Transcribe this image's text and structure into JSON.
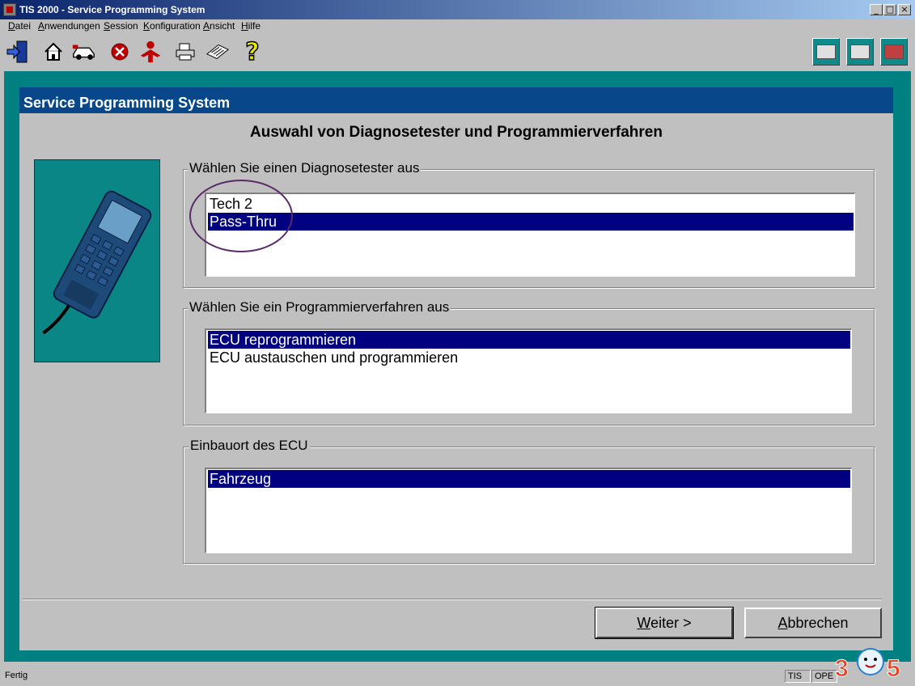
{
  "window": {
    "title": "TIS 2000 - Service Programming System",
    "controls": [
      "_",
      "□",
      "×"
    ]
  },
  "menu": [
    "Datei",
    "Anwendungen",
    "Session",
    "Konfiguration",
    "Ansicht",
    "Hilfe"
  ],
  "toolbar": {
    "icons": [
      "exit-icon",
      "home-icon",
      "vehicle-icon",
      "stop-icon",
      "person-icon",
      "printer-icon",
      "notebook-icon",
      "help-icon"
    ],
    "help_glyph": "?",
    "right_icons": [
      "diagnostic-device-icon",
      "computer-icon",
      "vehicle-programming-icon"
    ]
  },
  "panel": {
    "header": "Service Programming System",
    "heading": "Auswahl von Diagnosetester und Programmierverfahren"
  },
  "groups": {
    "tester": {
      "label": "Wählen Sie einen Diagnosetester aus",
      "items": [
        "Tech 2",
        "Pass-Thru"
      ],
      "selected": "Pass-Thru"
    },
    "procedure": {
      "label": "Wählen Sie ein Programmierverfahren aus",
      "items": [
        "ECU reprogrammieren",
        "ECU austauschen und programmieren"
      ],
      "selected": "ECU reprogrammieren"
    },
    "location": {
      "label": "Einbauort des ECU",
      "items": [
        "Fahrzeug"
      ],
      "selected": "Fahrzeug"
    }
  },
  "buttons": {
    "next": "Weiter >",
    "cancel": "Abbrechen"
  },
  "status": {
    "text": "Fertig",
    "cells": [
      "TIS",
      "OPE"
    ]
  },
  "watermark": "305",
  "colors": {
    "title_gradient_start": "#0a246a",
    "frame_teal": "#008080",
    "panel_header": "#08488a",
    "selection": "#000080",
    "annotation_circle": "#5a2a6a"
  }
}
